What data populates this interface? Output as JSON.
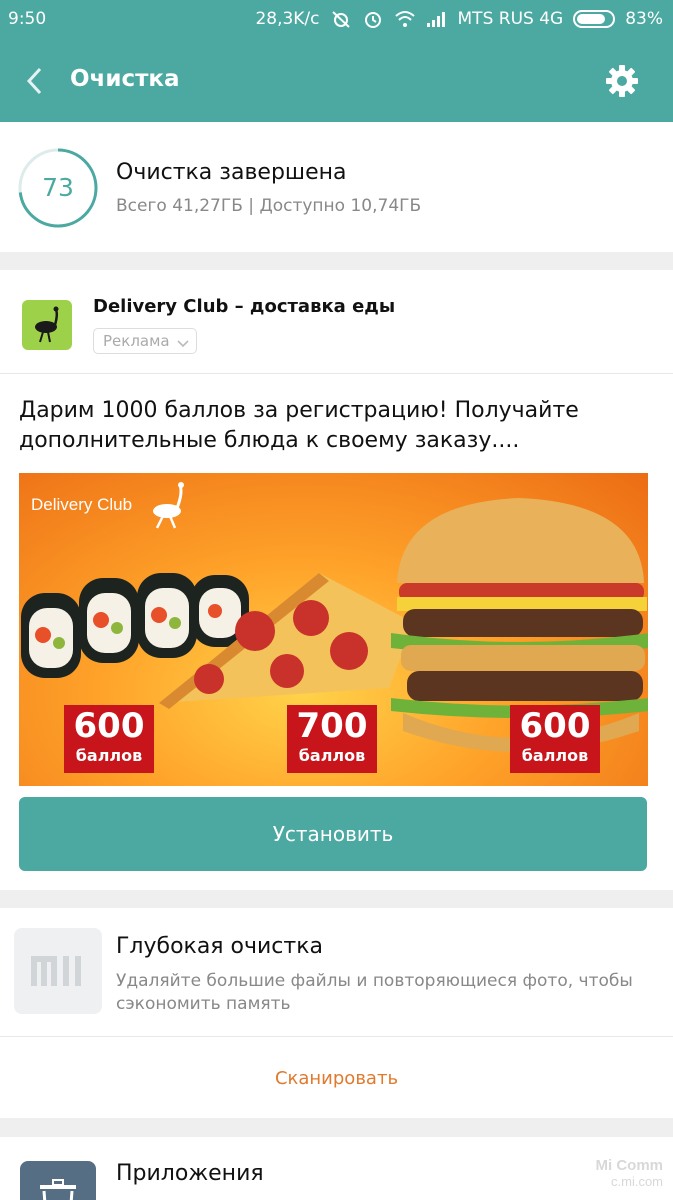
{
  "status_bar": {
    "time": "9:50",
    "speed": "28,3K/c",
    "carrier": "MTS RUS 4G",
    "battery": "83%",
    "battery_level": 0.83
  },
  "header": {
    "title": "Очистка",
    "back_icon": "chevron-left-icon",
    "settings_icon": "gear-icon"
  },
  "summary": {
    "score": "73",
    "title": "Очистка завершена",
    "subtitle": "Всего 41,27ГБ | Доступно 10,74ГБ"
  },
  "ad": {
    "app_name": "Delivery Club – доставка еды",
    "badge": "Реклама",
    "text": "Дарим 1000 баллов за регистрацию! Получайте дополнительные блюда к своему заказу....",
    "banner": {
      "brand": "Delivery Club",
      "offers": [
        {
          "points": "600",
          "label": "баллов"
        },
        {
          "points": "700",
          "label": "баллов"
        },
        {
          "points": "600",
          "label": "баллов"
        }
      ]
    },
    "install_label": "Установить"
  },
  "deep_clean": {
    "title": "Глубокая очистка",
    "description": "Удаляйте большие файлы и повторяющиеся фото, чтобы сэкономить память",
    "scan_label": "Сканировать"
  },
  "apps": {
    "title": "Приложения"
  },
  "watermark": {
    "line1": "Mi Comm",
    "line2": "c.mi.com"
  },
  "colors": {
    "accent": "#4ca9a2",
    "link": "#e07a2e",
    "badge_red": "#c8151b"
  }
}
